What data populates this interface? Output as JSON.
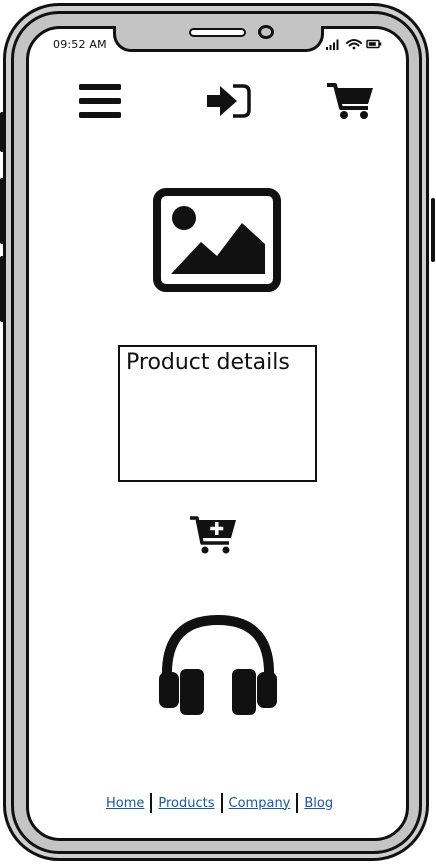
{
  "status_bar": {
    "time": "09:52 AM",
    "icons": [
      "signal-icon",
      "wifi-icon",
      "battery-icon"
    ]
  },
  "toolbar": {
    "icons": [
      "hamburger-menu-icon",
      "sign-in-icon",
      "shopping-cart-icon"
    ]
  },
  "main": {
    "image_placeholder_icon": "image-icon",
    "product_details": {
      "title": "Product details"
    },
    "add_to_cart_icon": "cart-plus-icon",
    "product_icon": "headphones-icon"
  },
  "footer": {
    "links": [
      "Home",
      "Products",
      "Company",
      "Blog"
    ],
    "link_color": "#1a56a6"
  }
}
